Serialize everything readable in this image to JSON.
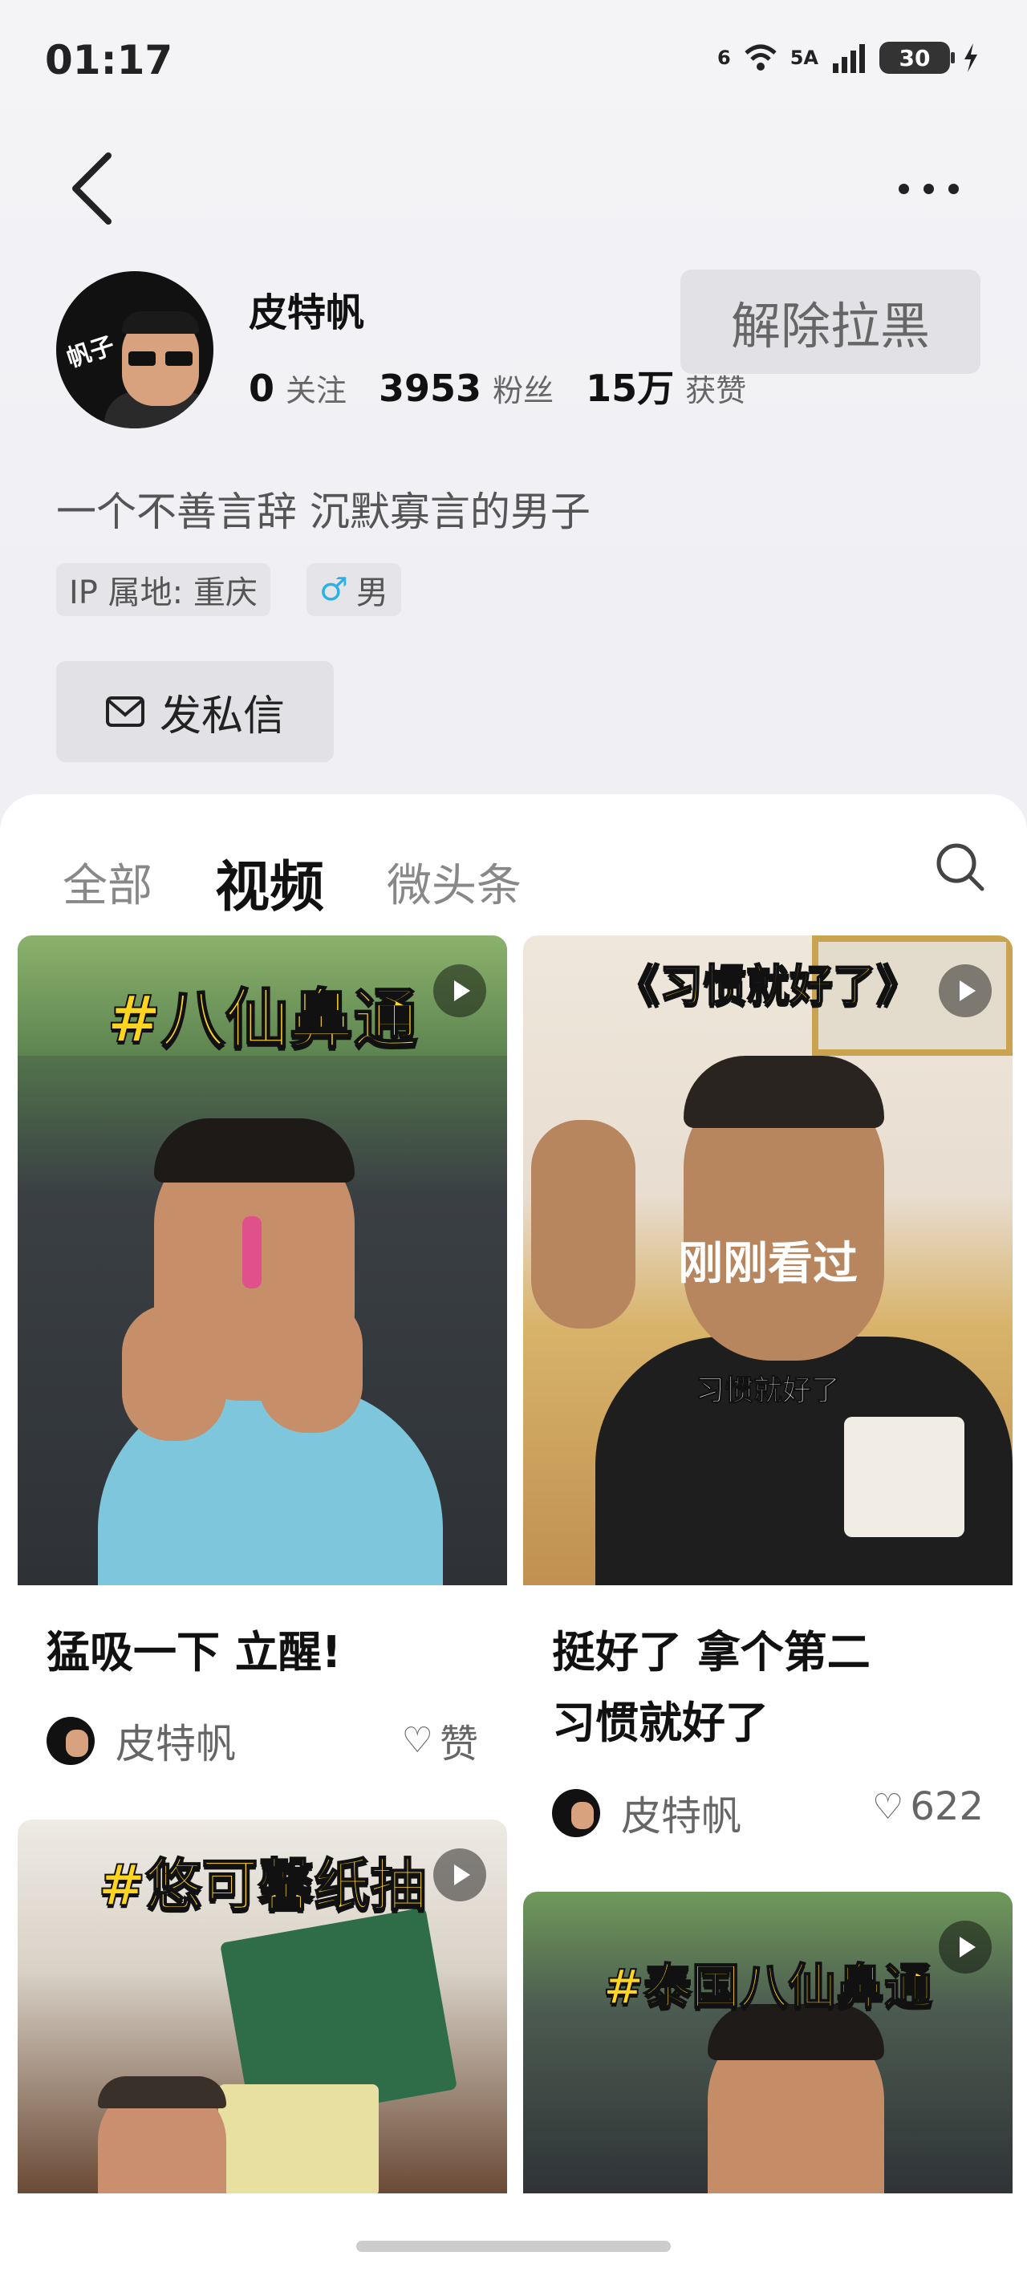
{
  "status_bar": {
    "time": "01:17",
    "wifi_label": "6",
    "network_label": "5A",
    "battery": "30"
  },
  "profile": {
    "avatar_text": "帆子",
    "name": "皮特帆",
    "stats": [
      {
        "value": "0",
        "label": "关注"
      },
      {
        "value": "3953",
        "label": "粉丝"
      },
      {
        "value": "15万",
        "label": "获赞"
      }
    ],
    "unblock_label": "解除拉黑",
    "bio": "一个不善言辞 沉默寡言的男子",
    "ip_tag": "IP 属地: 重庆",
    "gender_symbol": "♂",
    "gender_tag": "男",
    "dm_label": "发私信"
  },
  "tabs": [
    {
      "label": "全部",
      "active": false
    },
    {
      "label": "视频",
      "active": true
    },
    {
      "label": "微头条",
      "active": false
    }
  ],
  "cards": [
    {
      "thumb_text": "#八仙鼻通",
      "title": "猛吸一下 立醒!",
      "author": "皮特帆",
      "likes": "赞"
    },
    {
      "thumb_text": "《习惯就好了》",
      "overlay": "刚刚看过",
      "caption": "习惯就好了",
      "title_line1": "挺好了 拿个第二",
      "title_line2": "习惯就好了",
      "author": "皮特帆",
      "likes": "622"
    },
    {
      "thumb_text": "#悠可馨纸抽"
    },
    {
      "thumb_text": "#泰国八仙鼻通"
    }
  ],
  "icons": [
    "back-icon",
    "more-icon",
    "mail-icon",
    "search-icon",
    "play-icon",
    "heart-icon",
    "wifi-icon",
    "signal-icon",
    "battery-icon",
    "charging-icon"
  ]
}
